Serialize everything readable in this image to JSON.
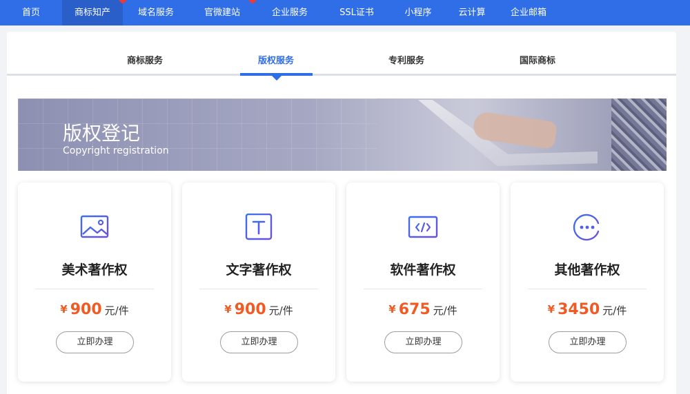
{
  "nav": {
    "items": [
      "首页",
      "商标知产",
      "域名服务",
      "官微建站",
      "企业服务",
      "SSL证书",
      "小程序",
      "云计算",
      "企业邮箱"
    ]
  },
  "tabs": [
    "商标服务",
    "版权服务",
    "专利服务",
    "国际商标"
  ],
  "banner": {
    "title": "版权登记",
    "subtitle": "Copyright registration"
  },
  "cards": [
    {
      "title": "美术著作权",
      "currency": "¥",
      "price": "900",
      "unit": "元/件",
      "button": "立即办理",
      "icon": "image-icon"
    },
    {
      "title": "文字著作权",
      "currency": "¥",
      "price": "900",
      "unit": "元/件",
      "button": "立即办理",
      "icon": "text-icon"
    },
    {
      "title": "软件著作权",
      "currency": "¥",
      "price": "675",
      "unit": "元/件",
      "button": "立即办理",
      "icon": "code-icon"
    },
    {
      "title": "其他著作权",
      "currency": "¥",
      "price": "3450",
      "unit": "元/件",
      "button": "立即办理",
      "icon": "more-icon"
    }
  ],
  "colors": {
    "nav_bg": "#2f6ee6",
    "accent": "#2f6ee6",
    "price": "#f15a22",
    "badge": "#e83b3b"
  }
}
